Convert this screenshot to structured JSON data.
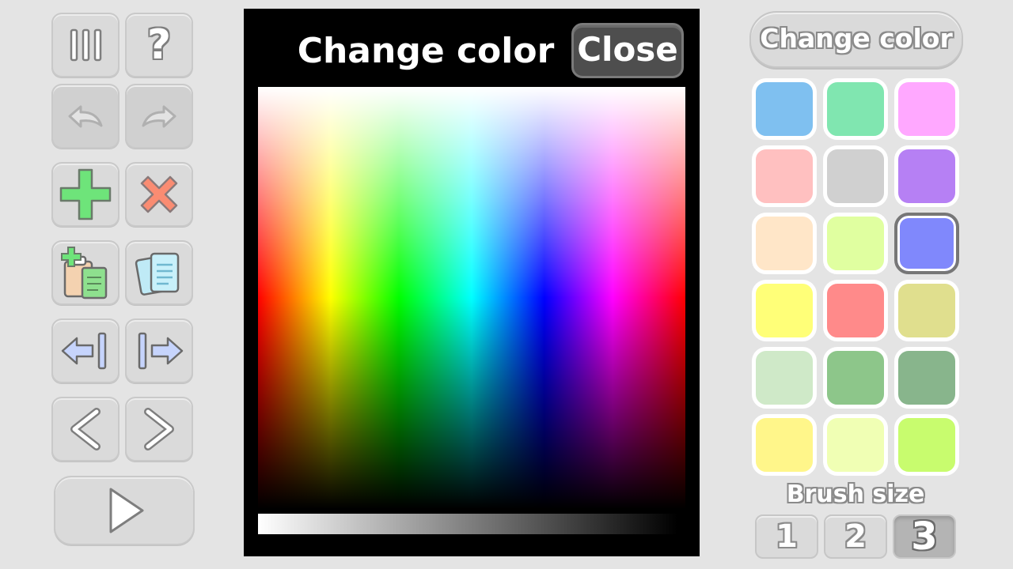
{
  "toolbar": {
    "icons": [
      "menu-icon",
      "help-icon",
      "undo-icon",
      "redo-icon",
      "add-icon",
      "delete-icon",
      "paste-add-icon",
      "copy-icon",
      "move-first-icon",
      "move-last-icon",
      "prev-icon",
      "next-icon",
      "play-icon"
    ],
    "help_label": "?",
    "disabled": [
      "undo",
      "redo"
    ]
  },
  "dialog": {
    "title": "Change color",
    "close_label": "Close"
  },
  "palette": {
    "button_label": "Change color",
    "swatches": [
      "#7fc0f0",
      "#80e6b0",
      "#ffa8ff",
      "#ffc0c0",
      "#d0d0d0",
      "#b680f4",
      "#ffe6c8",
      "#e0ffa0",
      "#8088fc",
      "#ffff78",
      "#ff8a8a",
      "#e0df8e",
      "#cfe9c8",
      "#8dc68a",
      "#88b58c",
      "#fff68a",
      "#f0ffb4",
      "#c8fc6e"
    ],
    "selected_index": 8
  },
  "brush": {
    "label": "Brush size",
    "sizes": [
      "1",
      "2",
      "3"
    ],
    "selected": "3"
  }
}
